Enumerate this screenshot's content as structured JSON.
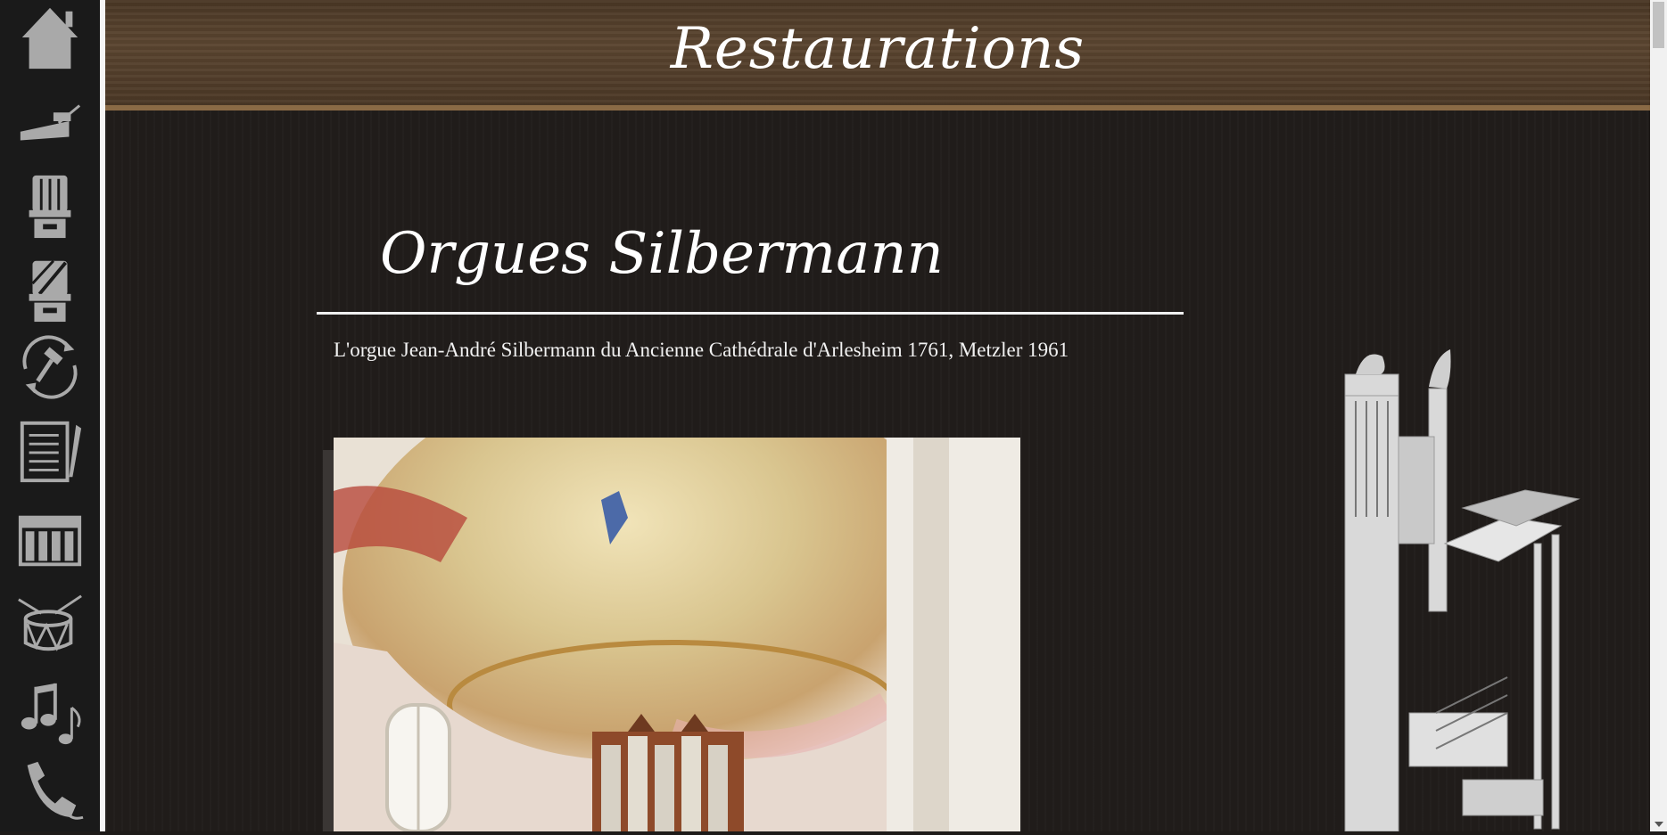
{
  "header": {
    "title": "Restaurations"
  },
  "sidebar": {
    "items": [
      {
        "icon": "home-icon"
      },
      {
        "icon": "plane-tool-icon"
      },
      {
        "icon": "organ-icon"
      },
      {
        "icon": "organ-restoration-icon"
      },
      {
        "icon": "hammer-cycle-icon"
      },
      {
        "icon": "checklist-icon"
      },
      {
        "icon": "piano-keys-icon"
      },
      {
        "icon": "drum-icon"
      },
      {
        "icon": "music-notes-icon"
      },
      {
        "icon": "phone-icon"
      }
    ]
  },
  "main": {
    "section_title": "Orgues Silbermann",
    "caption": "L'orgue Jean-André Silbermann du Ancienne Cathédrale d'Arlesheim 1761, Metzler 1961"
  },
  "colors": {
    "sidebar_bg": "#1a1a1a",
    "icon_gray": "#a9a9a9",
    "header_wood": "#4f3b28",
    "main_bg": "#211d1b"
  }
}
